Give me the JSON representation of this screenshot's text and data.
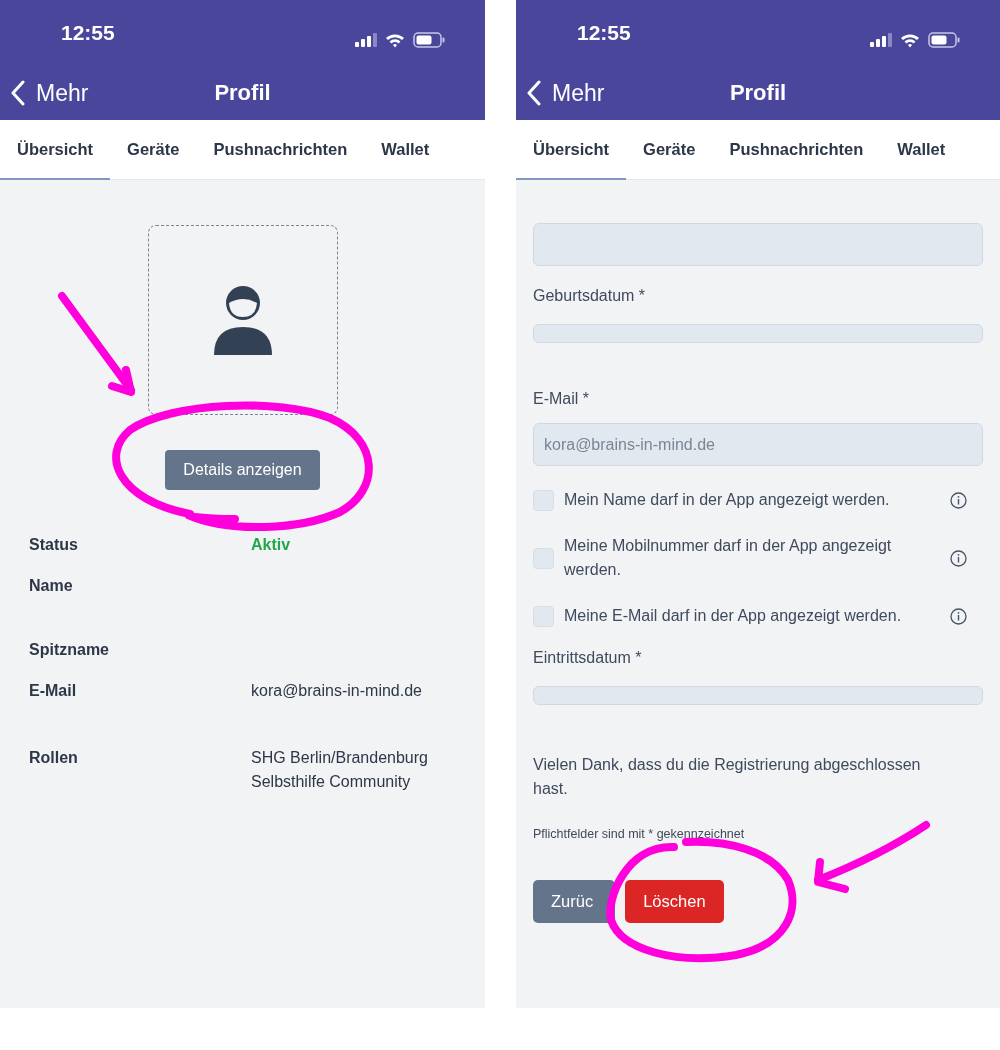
{
  "screens": [
    {
      "kind": "profile",
      "status_bar": {
        "time": "12:55"
      },
      "header": {
        "back": "Mehr",
        "title": "Profil"
      },
      "tabs": [
        {
          "label": "Übersicht",
          "selected": true
        },
        {
          "label": "Geräte",
          "selected": false
        },
        {
          "label": "Pushnachrichten",
          "selected": false
        },
        {
          "label": "Wallet",
          "selected": false
        }
      ],
      "details_button": "Details anzeigen",
      "info_rows": [
        {
          "kind": "status",
          "label": "Status",
          "value": "Aktiv"
        },
        {
          "kind": "empty",
          "label": "Name"
        },
        {
          "kind": "empty",
          "label": "Spitzname"
        },
        {
          "kind": "text",
          "label": "E-Mail",
          "value": "kora@brains-in-mind.de"
        },
        {
          "kind": "text",
          "label": "Rollen",
          "value": "SHG Berlin/Brandenburg\nSelbsthilfe Community"
        }
      ],
      "annotations": [
        {
          "kind": "arrow"
        },
        {
          "kind": "circle"
        }
      ]
    },
    {
      "kind": "form",
      "status_bar": {
        "time": "12:55"
      },
      "header": {
        "back": "Mehr",
        "title": "Profil"
      },
      "tabs": [
        {
          "label": "Übersicht",
          "selected": true
        },
        {
          "label": "Geräte",
          "selected": false
        },
        {
          "label": "Pushnachrichten",
          "selected": false
        },
        {
          "label": "Wallet",
          "selected": false
        }
      ],
      "form": [
        {
          "kind": "field"
        },
        {
          "kind": "date",
          "label": "Geburtsdatum *"
        },
        {
          "kind": "field",
          "label": "E-Mail *",
          "value": "kora@brains-in-mind.de"
        },
        {
          "kind": "checkbox",
          "label": "Mein Name darf in der App angezeigt werden.",
          "checked": false
        },
        {
          "kind": "checkbox",
          "label": "Meine Mobilnummer darf in der App angezeigt werden.",
          "checked": false
        },
        {
          "kind": "checkbox",
          "label": "Meine E-Mail darf in der App angezeigt werden.",
          "checked": false
        },
        {
          "kind": "date",
          "label": "Eintrittsdatum *"
        },
        {
          "kind": "text",
          "label": "Vielen Dank, dass du die Registrierung abgeschlossen hast."
        },
        {
          "kind": "note",
          "label": "Pflichtfelder sind mit * gekennzeichnet"
        }
      ],
      "buttons": [
        {
          "kind": "secondary",
          "label": "Zurüc"
        },
        {
          "kind": "danger",
          "label": "Löschen"
        }
      ],
      "annotations": [
        {
          "kind": "circle"
        },
        {
          "kind": "arrow"
        }
      ]
    }
  ]
}
